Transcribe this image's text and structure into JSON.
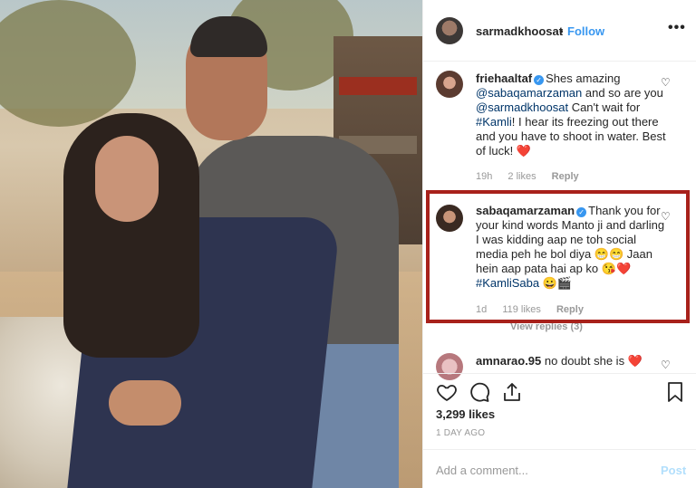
{
  "post": {
    "header": {
      "username": "sarmadkhoosat",
      "separator": "•",
      "follow_label": "Follow",
      "more_icon": "more-horizontal-icon"
    },
    "comments": [
      {
        "username": "friehaaltaf",
        "verified": true,
        "parts": [
          {
            "t": "Shes amazing "
          },
          {
            "t": "@sabaqamarzaman",
            "mention": true
          },
          {
            "t": " and so are you "
          },
          {
            "t": "@sarmadkhoosat",
            "mention": true
          },
          {
            "t": " Can't wait for "
          },
          {
            "t": "#Kamli",
            "mention": true
          },
          {
            "t": "! I hear its freezing out there and you have to shoot in water. Best of luck! ❤️"
          }
        ],
        "time": "19h",
        "likes": "2 likes",
        "reply_label": "Reply"
      },
      {
        "username": "sabaqamarzaman",
        "verified": true,
        "parts": [
          {
            "t": "Thank you for your kind words Manto ji and darling I was kidding aap ne toh social media peh he bol diya 😁😁 Jaan hein aap pata hai ap ko 😘❤️ "
          },
          {
            "t": "#KamliSaba",
            "mention": true
          },
          {
            "t": " 😀🎬"
          }
        ],
        "time": "1d",
        "likes": "119 likes",
        "reply_label": "Reply",
        "view_replies": "View replies (3)"
      },
      {
        "username": "amnarao.95",
        "verified": false,
        "parts": [
          {
            "t": "no doubt she is ❤️"
          }
        ]
      }
    ],
    "likes_count": "3,299 likes",
    "date": "1 DAY AGO",
    "add_comment_placeholder": "Add a comment...",
    "post_label": "Post",
    "icons": {
      "like": "heart-outline-icon",
      "comment": "comment-icon",
      "share": "share-icon",
      "save": "bookmark-icon",
      "comment_like": "heart-small-icon",
      "verified": "verified-badge-icon"
    },
    "colors": {
      "accent": "#3897f0",
      "mention": "#003569",
      "highlight_border": "#a8211b",
      "muted": "#999999"
    }
  }
}
